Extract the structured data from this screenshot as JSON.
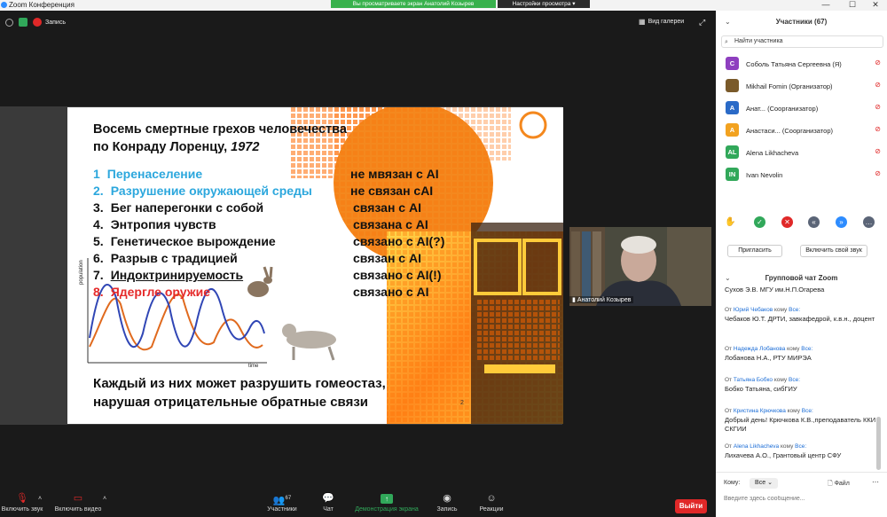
{
  "window": {
    "title": "Zoom Конференция",
    "share_banner": "Вы просматриваете экран Анатолий Козырев",
    "view_options": "Настройки просмотра",
    "minimize": "—",
    "maximize": "☐",
    "close": "✕"
  },
  "topbar": {
    "record_label": "Запись",
    "gallery_label": "Вид галереи",
    "fullscreen_icon": "⤢"
  },
  "slide": {
    "title_line1": "Восемь смертные грехов человечества",
    "title_line2": "по Конраду Лоренцу, ",
    "title_year": "1972",
    "items": [
      {
        "num": "1",
        "text": "Перенаселение",
        "status": "не мвязан с AI",
        "color": "#2ca7dd"
      },
      {
        "num": "2.",
        "text": "Разрушение окружающей среды",
        "status": "не связан сAI",
        "color": "#2ca7dd"
      },
      {
        "num": "3.",
        "text": "Бег наперегонки с собой",
        "status": "связан с AI",
        "color": "#111111"
      },
      {
        "num": "4.",
        "text": "Энтропия чувств",
        "status": "связана с AI",
        "color": "#111111"
      },
      {
        "num": "5.",
        "text": "Генетическое вырождение",
        "status": "связано с AI(?)",
        "color": "#111111"
      },
      {
        "num": "6.",
        "text": "Разрыв с традицией",
        "status": "связан с AI",
        "color": "#111111"
      },
      {
        "num": "7.",
        "text": "Индоктринируемость",
        "status": "связано с AI(!)",
        "color": "#111111"
      },
      {
        "num": "8.",
        "text": "Ядергле оружие",
        "status": "связано с AI",
        "color": "#e52a2a"
      }
    ],
    "graph_ylabel": "population",
    "graph_xlabel": "time",
    "footer_line1": "Каждый из них может разрушить гомеостаз,",
    "footer_line2": "нарушая  отрицательные обратные связи",
    "page_number": "2"
  },
  "video": {
    "name": "Анатолий Козырев"
  },
  "toolbar": {
    "mute": "Включить звук",
    "video": "Включить видео",
    "participants": "Участники",
    "participants_count": "67",
    "chat": "Чат",
    "share": "Демонстрация экрана",
    "record": "Запись",
    "reactions": "Реакции",
    "leave": "Выйти"
  },
  "participants": {
    "header": "Участники (67)",
    "search_placeholder": "Найти участника",
    "list": [
      {
        "initials": "С",
        "name": "Соболь Татьяна Сергеевна (Я)",
        "color": "#8e3fbf"
      },
      {
        "initials": "",
        "name": "Mikhail Fomin (Организатор)",
        "color": "#7a5a2a"
      },
      {
        "initials": "А",
        "name": "Анат...  (Соорганизатор)",
        "color": "#2a6ac7"
      },
      {
        "initials": "А",
        "name": "Анастаси...  (Соорганизатор)",
        "color": "#f2a220"
      },
      {
        "initials": "AL",
        "name": "Alena Likhacheva",
        "color": "#31a85a"
      },
      {
        "initials": "IN",
        "name": "Ivan Nevolin",
        "color": "#31a85a"
      }
    ],
    "invite": "Пригласить",
    "unmute_me": "Включить свой звук"
  },
  "chat": {
    "header": "Групповой чат Zoom",
    "truncated_line": "Сухов Э.В. МГУ им.Н.П.Огарева",
    "from_prefix": "От",
    "to_word": "кому",
    "messages": [
      {
        "from": "Юрий Чебаков",
        "to": "Все:",
        "text": "Чебаков Ю.Т. ДРТИ, завкафедрой, к.в.н., доцент"
      },
      {
        "from": "Надежда Лобанова",
        "to": "Все:",
        "text": "Лобанова Н.А., РТУ МИРЭА"
      },
      {
        "from": "Татьяна Бобко",
        "to": "Все:",
        "text": "Бобко Татьяна, сибГИУ"
      },
      {
        "from": "Кристина Крючкова",
        "to": "Все:",
        "text": "Добрый день! Крючкова К.В.,преподаватель ККИ СКГИИ"
      },
      {
        "from": "Alena Likhacheva",
        "to": "Все:",
        "text": "Лихачева А.О., Грантовый центр СФУ"
      }
    ],
    "to_label": "Кому:",
    "to_value": "Все",
    "file_label": "Файл",
    "input_placeholder": "Введите здесь сообщение..."
  }
}
